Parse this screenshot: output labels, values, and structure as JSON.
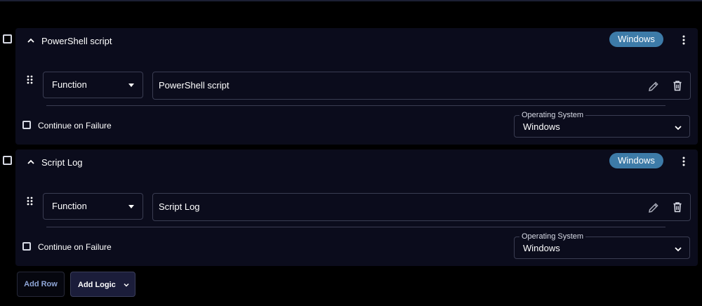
{
  "steps": [
    {
      "title": "PowerShell script",
      "os_chip": "Windows",
      "function_label": "Function",
      "script_value": "PowerShell script",
      "continue_on_failure_label": "Continue on Failure",
      "os_select_legend": "Operating System",
      "os_select_value": "Windows"
    },
    {
      "title": "Script Log",
      "os_chip": "Windows",
      "function_label": "Function",
      "script_value": "Script Log",
      "continue_on_failure_label": "Continue on Failure",
      "os_select_legend": "Operating System",
      "os_select_value": "Windows"
    }
  ],
  "footer": {
    "add_row_label": "Add Row",
    "add_logic_label": "Add Logic"
  },
  "colors": {
    "background": "#000000",
    "card": "#0b0c1c",
    "chip": "#3d7ba8",
    "add_logic_bg": "#1b1d3a",
    "add_row_text": "#8fa6d8"
  },
  "icons": [
    "chevron-up-icon",
    "kebab-menu-icon",
    "drag-handle-icon",
    "caret-down-icon",
    "edit-icon",
    "trash-icon",
    "chevron-down-icon"
  ]
}
